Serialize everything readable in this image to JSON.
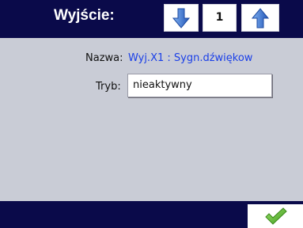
{
  "header": {
    "title": "Wyjście:",
    "counter_value": "1",
    "down_icon": "arrow-down-icon",
    "up_icon": "arrow-up-icon"
  },
  "form": {
    "name_label": "Nazwa:",
    "name_value": "Wyj.X1 : Sygn.dźwiękow",
    "mode_label": "Tryb:",
    "mode_value": "nieaktywny"
  },
  "footer": {
    "ok_icon": "checkmark-icon"
  },
  "colors": {
    "bar": "#0a0a4a",
    "panel": "#c9ccd6",
    "name_value": "#1a3fe8",
    "arrow": "#3a6fd0",
    "check": "#5cb82e"
  }
}
